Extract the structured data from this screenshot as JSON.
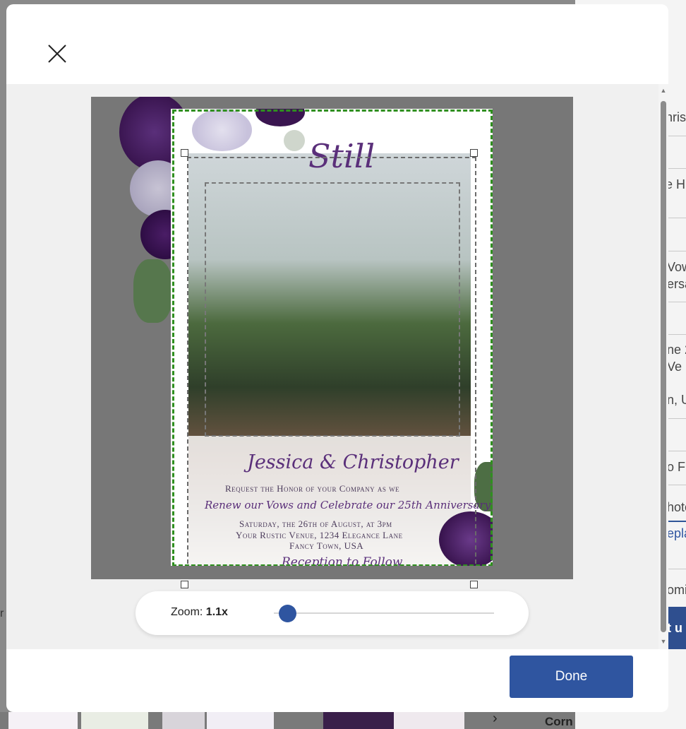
{
  "modal": {
    "close_icon": "close-icon",
    "zoom_label": "Zoom:",
    "zoom_value": "1.1x",
    "zoom_level": 1.1,
    "done_label": "Done"
  },
  "invitation": {
    "title_script": "Still",
    "names": "Jessica & Christopher",
    "line1": "Request the Honor of your Company as we",
    "line2": "Renew our Vows and Celebrate our 25th Anniversary",
    "line3": "Saturday, the 26th of August, at 3pm",
    "line4": "Your Rustic Venue, 1234 Elegance Lane",
    "line5": "Fancy Town, USA",
    "line6": "Reception to Follow"
  },
  "background": {
    "right_panel": [
      "hris",
      "e H",
      "Vow",
      "ersa",
      "ne 2",
      "Ve",
      "n, U",
      "o F",
      "hoto",
      "epla",
      "omi",
      "t u"
    ],
    "bottom_right": "Corn",
    "left_edge": "r"
  },
  "colors": {
    "accent": "#2f55a0",
    "crop_green": "#2f8f1f",
    "script_purple": "#5a2f7a"
  }
}
